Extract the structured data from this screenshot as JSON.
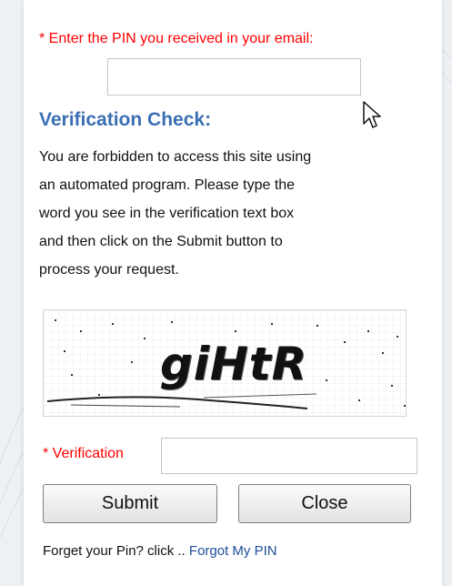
{
  "pin": {
    "label": "* Enter the PIN you received in your email:",
    "value": ""
  },
  "verification": {
    "title": "Verification Check:",
    "lines": [
      "You are forbidden to access this site using",
      "an automated program. Please type the",
      "word you see in the verification text box",
      "and then click on the Submit button to",
      "process your request."
    ],
    "captcha_word": "giHtR",
    "field_label": "* Verification",
    "field_value": ""
  },
  "buttons": {
    "submit": "Submit",
    "close": "Close"
  },
  "forgot": {
    "prefix": "Forget your Pin? click .. ",
    "link": "Forgot My PIN"
  },
  "colors": {
    "required_label": "#ff0000",
    "title": "#3b6fb3",
    "link": "#1f4f99"
  },
  "icons": {
    "cursor": "mouse-pointer-icon"
  }
}
